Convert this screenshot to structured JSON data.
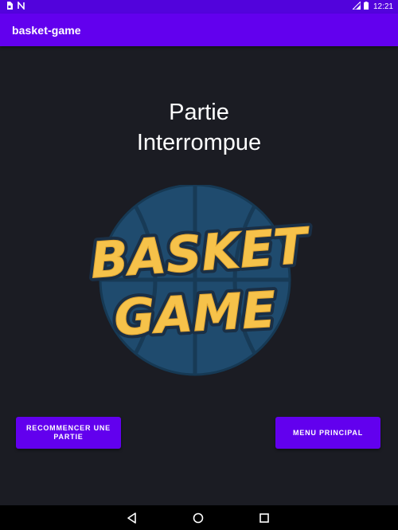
{
  "status_bar": {
    "time": "12:21",
    "icons": [
      "sim-card-icon",
      "nfc-icon",
      "signal-icon",
      "battery-icon"
    ]
  },
  "app_bar": {
    "title": "basket-game"
  },
  "screen": {
    "title_line1": "Partie",
    "title_line2": "Interrompue"
  },
  "logo": {
    "line1": "BASKET",
    "line2": "GAME",
    "colors": {
      "ball": "#1f4b6e",
      "ball_dark": "#173a56",
      "text": "#f6c24a",
      "outline": "#1a2f45"
    }
  },
  "buttons": {
    "restart_label": "RECOMMENCER UNE PARTIE",
    "menu_label": "MENU PRINCIPAL"
  },
  "nav": {
    "icons": [
      "back-icon",
      "home-icon",
      "recents-icon"
    ]
  },
  "colors": {
    "primary": "#6200ee",
    "primary_dark": "#5203dc",
    "background": "#1b1c23"
  }
}
